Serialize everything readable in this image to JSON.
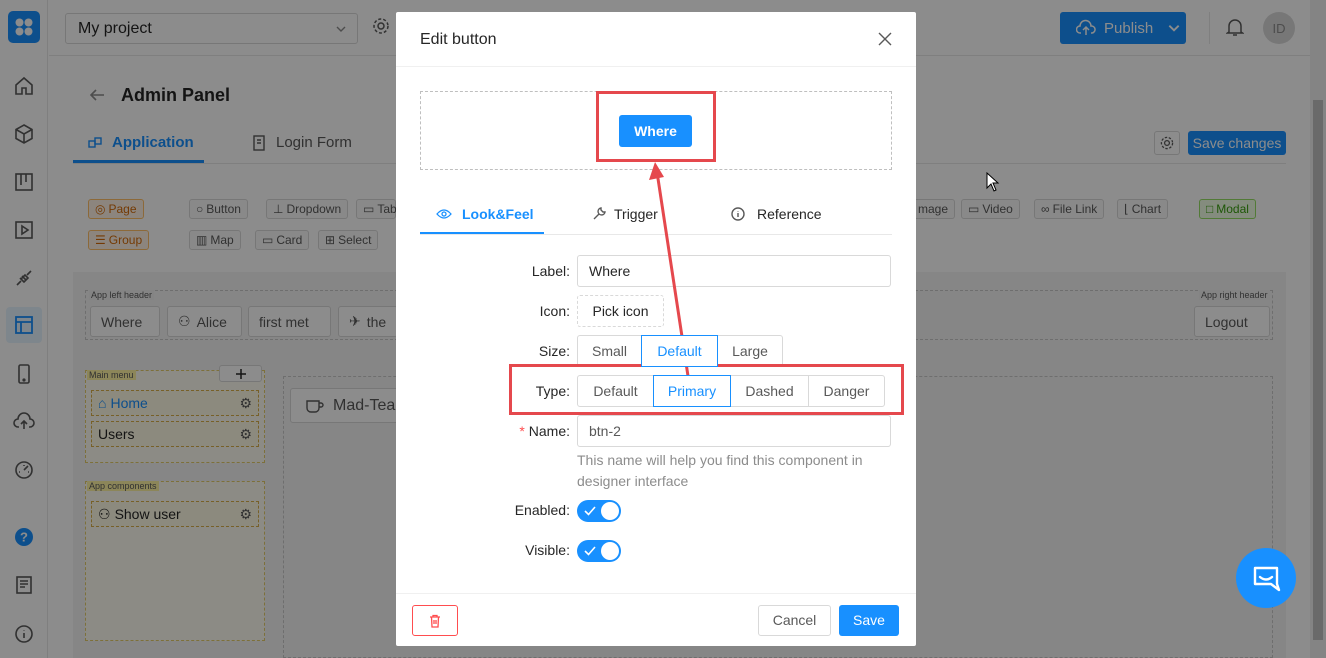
{
  "topbar": {
    "project": "My project",
    "publish": "Publish",
    "avatar": "ID"
  },
  "page": {
    "title": "Admin Panel",
    "tabs": [
      "Application",
      "Login Form"
    ],
    "save_changes": "Save changes"
  },
  "components_row1": [
    "Page",
    "Button",
    "Dropdown",
    "Tab",
    "mage",
    "Video",
    "File Link",
    "Chart",
    "Modal"
  ],
  "components_row2": [
    "Group",
    "Map",
    "Card",
    "Select"
  ],
  "header": {
    "left_label": "App left header",
    "right_label": "App right header",
    "buttons": [
      "Where",
      "Alice",
      "first met",
      "the"
    ],
    "logout": "Logout"
  },
  "menu": {
    "label": "Main menu",
    "items": [
      "Home",
      "Users"
    ]
  },
  "app_components": {
    "label": "App components",
    "items": [
      "Show user"
    ]
  },
  "canvas": {
    "item": "Mad-Tea"
  },
  "modal": {
    "title": "Edit button",
    "preview_button": "Where",
    "tabs": [
      "Look&Feel",
      "Trigger",
      "Reference"
    ],
    "label_field": {
      "label": "Label:",
      "value": "Where"
    },
    "icon_field": {
      "label": "Icon:",
      "button": "Pick icon"
    },
    "size_field": {
      "label": "Size:",
      "options": [
        "Small",
        "Default",
        "Large"
      ],
      "selected": "Default"
    },
    "type_field": {
      "label": "Type:",
      "options": [
        "Default",
        "Primary",
        "Dashed",
        "Danger"
      ],
      "selected": "Primary"
    },
    "name_field": {
      "required_mark": "*",
      "label": "Name:",
      "value": "btn-2",
      "hint": "This name will help you find this component in designer interface"
    },
    "enabled": {
      "label": "Enabled:",
      "on": true
    },
    "visible": {
      "label": "Visible:",
      "on": true
    },
    "cancel": "Cancel",
    "save": "Save"
  },
  "colors": {
    "primary": "#1890ff",
    "annotation": "#e5484d",
    "danger": "#ff4d4f"
  }
}
